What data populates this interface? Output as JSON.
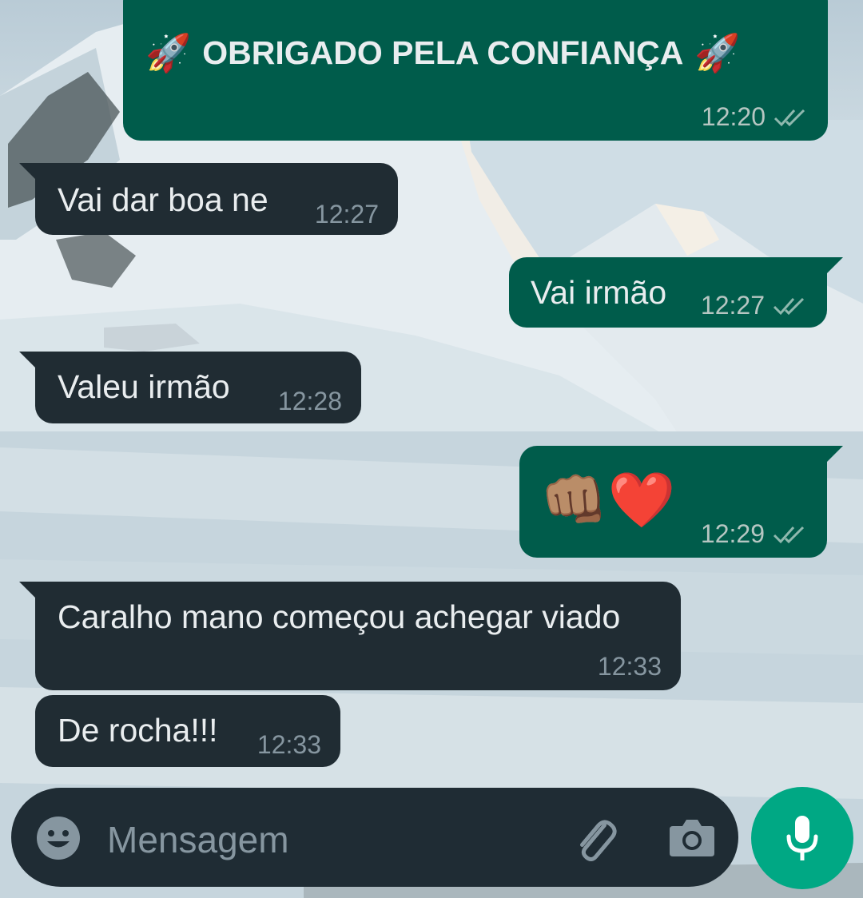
{
  "theme": {
    "outgoing_bubble": "#005c4b",
    "incoming_bubble": "#202c33",
    "accent": "#00a884",
    "input_bar": "#1f2c34"
  },
  "messages": [
    {
      "direction": "out",
      "emoji_left": "🚀",
      "text": "OBRIGADO PELA CONFIANÇA",
      "emoji_right": "🚀",
      "time": "12:20",
      "status": "read"
    },
    {
      "direction": "in",
      "text": "Vai dar boa ne",
      "time": "12:27"
    },
    {
      "direction": "out",
      "text": "Vai irmão",
      "time": "12:27",
      "status": "read"
    },
    {
      "direction": "in",
      "text": "Valeu irmão",
      "time": "12:28"
    },
    {
      "direction": "out",
      "text": "👊🏽❤️",
      "time": "12:29",
      "status": "read"
    },
    {
      "direction": "in",
      "text": "Caralho mano começou achegar viado",
      "time": "12:33"
    },
    {
      "direction": "in",
      "text": "De rocha!!!",
      "time": "12:33"
    }
  ],
  "composer": {
    "placeholder": "Mensagem",
    "icons": [
      "emoji-icon",
      "attachment-icon",
      "camera-icon",
      "microphone-icon"
    ]
  }
}
